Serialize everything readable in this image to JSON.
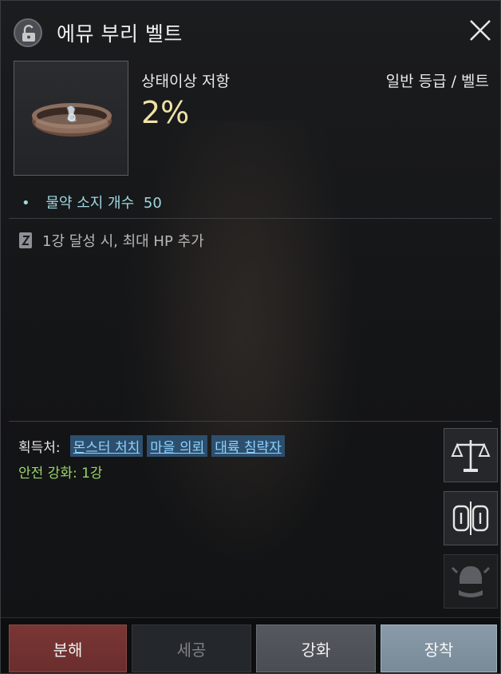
{
  "window": {
    "title": "에뮤 부리 벨트",
    "lock_icon": "unlock-icon",
    "close_icon": "close-icon"
  },
  "item": {
    "icon": "belt-icon",
    "stat_label": "상태이상 저항",
    "stat_value": "2%",
    "grade": "일반 등급 / 벨트"
  },
  "effects": [
    {
      "bullet": "•",
      "text": "물약 소지 개수",
      "value": "50"
    }
  ],
  "bonus": {
    "icon": "scroll-icon",
    "text": "1강 달성 시, 최대 HP 추가"
  },
  "acquisition": {
    "label": "획득처:",
    "links": [
      "몬스터 처치",
      "마을 의뢰",
      "대륙 침략자"
    ]
  },
  "safe_enhance": "안전 강화: 1강",
  "side_buttons": [
    {
      "name": "trade-scale-icon"
    },
    {
      "name": "compare-icon"
    },
    {
      "name": "collection-helmet-icon"
    }
  ],
  "footer": {
    "decompose": "분해",
    "refine": "세공",
    "enhance": "강화",
    "equip": "장착"
  },
  "colors": {
    "stat_value": "#f0e2a6",
    "effect": "#9fd7e0",
    "link": "#8fd3ff",
    "safe": "#9ad56a",
    "decompose_bg": "#7a3634",
    "equip_bg": "#8a9aa8"
  }
}
